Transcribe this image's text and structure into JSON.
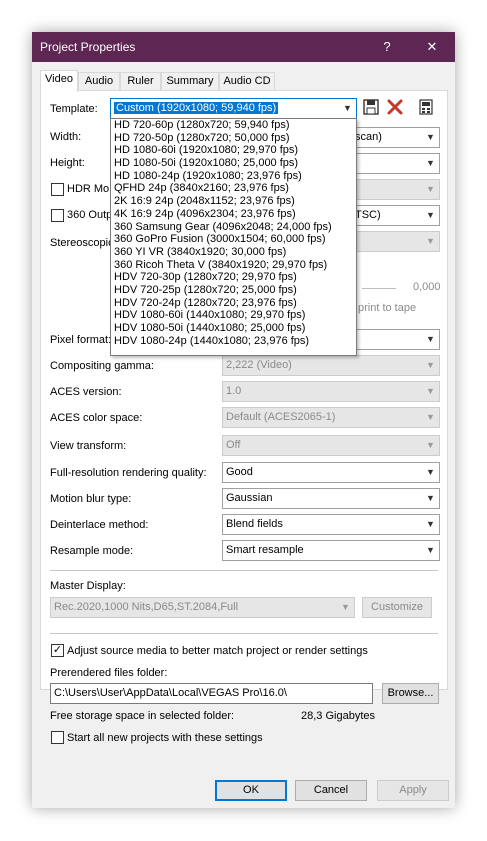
{
  "window": {
    "title": "Project Properties",
    "help_glyph": "?",
    "close_glyph": "✕"
  },
  "tabs": [
    "Video",
    "Audio",
    "Ruler",
    "Summary",
    "Audio CD"
  ],
  "template": {
    "label": "Template:",
    "selected": "Custom (1920x1080; 59,940 fps)",
    "options": [
      "HD 720-60p (1280x720; 59,940 fps)",
      "HD 720-50p (1280x720; 50,000 fps)",
      "HD 1080-60i (1920x1080; 29,970 fps)",
      "HD 1080-50i (1920x1080; 25,000 fps)",
      "HD 1080-24p (1920x1080; 23,976 fps)",
      "QFHD 24p (3840x2160; 23,976 fps)",
      "2K 16:9 24p (2048x1152; 23,976 fps)",
      "4K 16:9 24p (4096x2304; 23,976 fps)",
      "360 Samsung Gear (4096x2048; 24,000 fps)",
      "360 GoPro Fusion (3000x1504; 60,000 fps)",
      "360 YI VR (3840x1920; 30,000 fps)",
      "360 Ricoh Theta V (3840x1920; 29,970 fps)",
      "HDV 720-30p (1280x720; 29,970 fps)",
      "HDV 720-25p (1280x720; 25,000 fps)",
      "HDV 720-24p (1280x720; 23,976 fps)",
      "HDV 1080-60i (1440x1080; 29,970 fps)",
      "HDV 1080-50i (1440x1080; 25,000 fps)",
      "HDV 1080-24p (1440x1080; 23,976 fps)"
    ]
  },
  "toolbar_icons": [
    "save-template-icon",
    "delete-template-icon",
    "match-media-icon"
  ],
  "fields": {
    "width_label": "Width:",
    "width_combo_tail": "scan)",
    "height_label": "Height:",
    "hdr_label": "HDR Mo",
    "output_label": "360 Outp",
    "output_combo_tail": "TSC)",
    "stereo_label": "Stereoscopic",
    "slider_value": "0,000",
    "print_to_tape": "print to tape",
    "pixel_format_label": "Pixel format:"
  },
  "settings": [
    {
      "label": "Compositing gamma:",
      "value": "2,222 (Video)",
      "disabled": true
    },
    {
      "label": "ACES version:",
      "value": "1.0",
      "disabled": true
    },
    {
      "label": "ACES color space:",
      "value": "Default (ACES2065-1)",
      "disabled": true
    },
    {
      "label": "View transform:",
      "value": "Off",
      "disabled": true
    },
    {
      "label": "Full-resolution rendering quality:",
      "value": "Good",
      "disabled": false
    },
    {
      "label": "Motion blur type:",
      "value": "Gaussian",
      "disabled": false
    },
    {
      "label": "Deinterlace method:",
      "value": "Blend fields",
      "disabled": false
    },
    {
      "label": "Resample mode:",
      "value": "Smart resample",
      "disabled": false
    }
  ],
  "master_display": {
    "label": "Master Display:",
    "value": "Rec.2020,1000 Nits,D65,ST.2084,Full",
    "customize": "Customize"
  },
  "adjust": {
    "label": "Adjust source media to better match project or render settings",
    "checked": true
  },
  "prerendered": {
    "label": "Prerendered files folder:",
    "path": "C:\\Users\\User\\AppData\\Local\\VEGAS Pro\\16.0\\",
    "browse": "Browse..."
  },
  "storage": {
    "label": "Free storage space in selected folder:",
    "value": "28,3 Gigabytes"
  },
  "start_all": {
    "label": "Start all new projects with these settings",
    "checked": false
  },
  "footer": {
    "ok": "OK",
    "cancel": "Cancel",
    "apply": "Apply"
  },
  "colors": {
    "titlebar": "#5d2653",
    "selection": "#0078d7"
  }
}
